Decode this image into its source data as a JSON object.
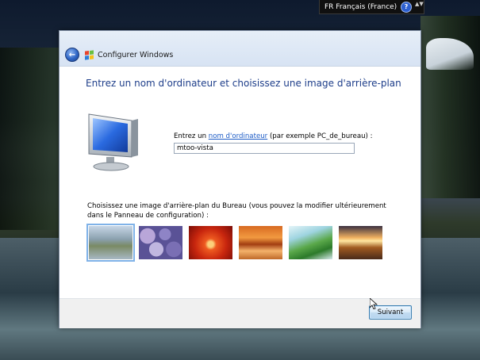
{
  "language_bar": {
    "language": "FR Français (France)",
    "help_glyph": "?",
    "options_glyph": "▲▼"
  },
  "window": {
    "title": "Configurer Windows",
    "heading": "Entrez un nom d'ordinateur et choisissez une image d'arrière-plan",
    "computer_name": {
      "label_before": "Entrez un ",
      "label_link": "nom d'ordinateur",
      "label_after": " (par exemple PC_de_bureau) :",
      "value": "mtoo-vista"
    },
    "background": {
      "label": "Choisissez une image d'arrière-plan du Bureau (vous pouvez la modifier ultérieurement dans le Panneau de configuration) :",
      "thumbnails": [
        {
          "name": "lake-landscape",
          "selected": true
        },
        {
          "name": "purple-pebbles",
          "selected": false
        },
        {
          "name": "red-flower",
          "selected": false
        },
        {
          "name": "rock-arch",
          "selected": false
        },
        {
          "name": "green-palm-leaf",
          "selected": false
        },
        {
          "name": "sunset-field",
          "selected": false
        }
      ]
    },
    "next_button": "Suivant"
  },
  "colors": {
    "heading": "#1e3e8a",
    "link": "#1c5bc6",
    "selection_outline": "#7fb2e8"
  }
}
